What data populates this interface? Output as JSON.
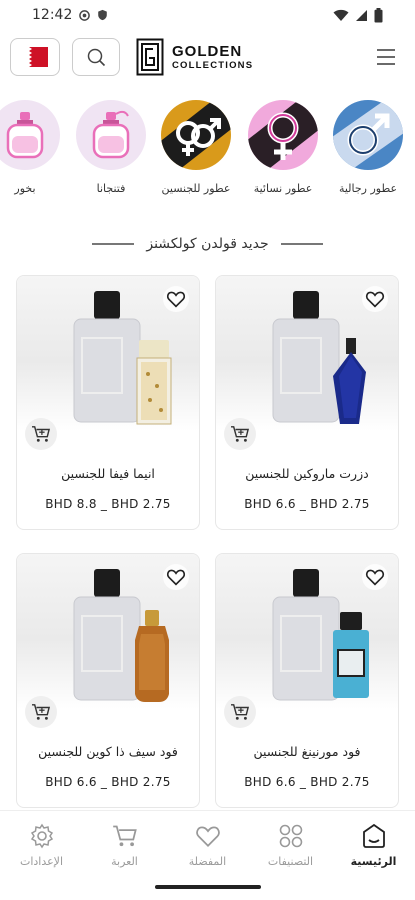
{
  "status_bar": {
    "time": "12:42"
  },
  "header": {
    "logo_line1": "GOLDEN",
    "logo_line2": "COLLECTIONS",
    "logo_mark": "G"
  },
  "categories": [
    {
      "label": "عطور رجالية",
      "icon": "male-symbol-icon",
      "bg": "#4a86c5"
    },
    {
      "label": "عطور نسائية",
      "icon": "female-symbol-icon",
      "bg": "#e88bcf"
    },
    {
      "label": "عطور للجنسين",
      "icon": "unisex-symbol-icon",
      "bg": "#d99a1b"
    },
    {
      "label": "فتنجانا",
      "icon": "perfume-bottle-icon",
      "bg": "#f2dff2"
    },
    {
      "label": "بخور",
      "icon": "perfume-bottle-icon",
      "bg": "#f2dff2"
    }
  ],
  "section": {
    "title": "جديد قولدن كولكشنز"
  },
  "products": [
    {
      "name": "دزرت ماروكين للجنسين",
      "price": "BHD 6.6 _ BHD 2.75",
      "accent": "#1a2a8a"
    },
    {
      "name": "انيما فيفا للجنسين",
      "price": "BHD 8.8 _ BHD 2.75",
      "accent": "#e7dfc2"
    },
    {
      "name": "فود مورنينغ للجنسين",
      "price": "BHD 6.6 _ BHD 2.75",
      "accent": "#4ab0d3"
    },
    {
      "name": "فود سيف ذا كوين للجنسين",
      "price": "BHD 6.6 _ BHD 2.75",
      "accent": "#b66a22"
    }
  ],
  "bottom_nav": [
    {
      "label": "الرئيسية",
      "icon": "home-icon",
      "active": true
    },
    {
      "label": "التصنيفات",
      "icon": "grid-icon",
      "active": false
    },
    {
      "label": "المفضلة",
      "icon": "heart-icon",
      "active": false
    },
    {
      "label": "العربة",
      "icon": "cart-icon",
      "active": false
    },
    {
      "label": "الإعدادات",
      "icon": "settings-icon",
      "active": false
    }
  ],
  "colors": {
    "brand_dark": "#111111",
    "flag_red": "#ce1126"
  }
}
